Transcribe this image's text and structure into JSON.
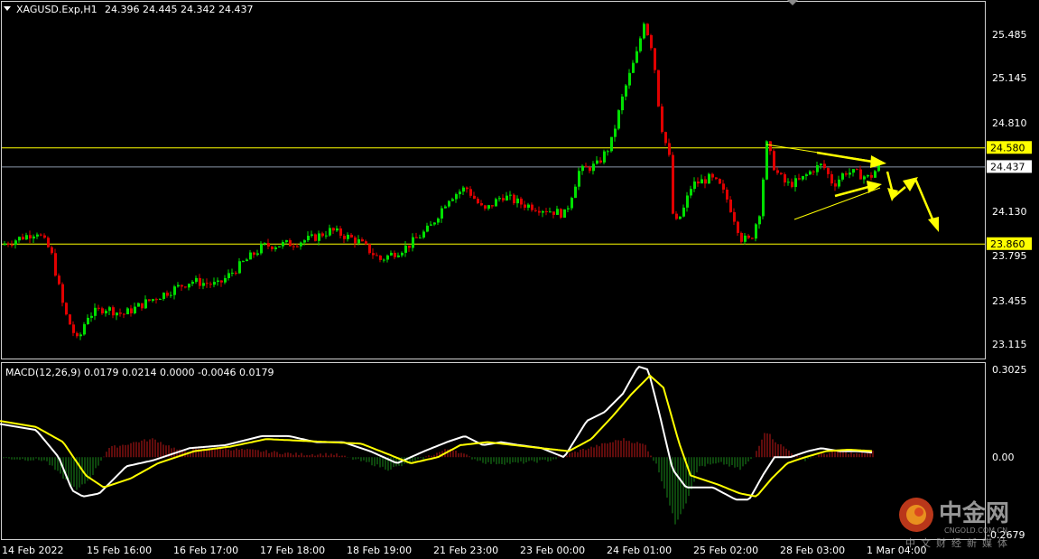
{
  "header": {
    "symbol": "XAGUSD.Exp,H1",
    "ohlc": "24.396 24.445 24.342 24.437"
  },
  "macd": {
    "label": "MACD(12,26,9) 0.0179 0.0214 0.0000 -0.0046 0.0179",
    "ticks": [
      "0.3025",
      "0.00",
      "-0.2679"
    ]
  },
  "price_axis": {
    "ticks": [
      "25.485",
      "25.145",
      "24.810",
      "24.130",
      "23.795",
      "23.455",
      "23.115"
    ]
  },
  "price_tags": [
    {
      "text": "24.580",
      "value": 24.58,
      "kind": "level"
    },
    {
      "text": "24.437",
      "value": 24.437,
      "kind": "current"
    },
    {
      "text": "23.860",
      "value": 23.86,
      "kind": "level"
    }
  ],
  "time_axis": {
    "ticks": [
      "14 Feb 2022",
      "15 Feb 16:00",
      "16 Feb 17:00",
      "17 Feb 18:00",
      "18 Feb 19:00",
      "21 Feb 23:00",
      "23 Feb 00:00",
      "24 Feb 01:00",
      "25 Feb 02:00",
      "28 Feb 03:00",
      "1 Mar 04:00"
    ]
  },
  "watermark": {
    "name": "中金网",
    "url": "CNGOLD.COM.CN",
    "slogan": "中文财经新媒体"
  },
  "colors": {
    "bull": "#00e000",
    "bear": "#e00000",
    "level_line": "#ffff00",
    "current_line": "#8a96a8",
    "macd_main": "#ffffff",
    "macd_signal": "#ffff00",
    "arrow": "#ffff00"
  },
  "chart_data": {
    "type": "candlestick",
    "title": "XAGUSD.Exp,H1",
    "ylim": [
      23.0,
      25.67
    ],
    "levels": [
      24.58,
      23.86
    ],
    "current_price": 24.437,
    "price_path": [
      [
        0,
        23.85
      ],
      [
        40,
        23.95
      ],
      [
        55,
        23.8
      ],
      [
        70,
        23.35
      ],
      [
        85,
        23.12
      ],
      [
        95,
        23.32
      ],
      [
        115,
        23.38
      ],
      [
        135,
        23.33
      ],
      [
        160,
        23.42
      ],
      [
        185,
        23.5
      ],
      [
        210,
        23.58
      ],
      [
        240,
        23.55
      ],
      [
        265,
        23.7
      ],
      [
        290,
        23.84
      ],
      [
        320,
        23.86
      ],
      [
        345,
        23.9
      ],
      [
        365,
        23.96
      ],
      [
        395,
        23.88
      ],
      [
        420,
        23.74
      ],
      [
        450,
        23.84
      ],
      [
        475,
        23.98
      ],
      [
        495,
        24.2
      ],
      [
        515,
        24.28
      ],
      [
        535,
        24.1
      ],
      [
        555,
        24.22
      ],
      [
        575,
        24.16
      ],
      [
        600,
        24.12
      ],
      [
        625,
        24.08
      ],
      [
        640,
        24.4
      ],
      [
        660,
        24.45
      ],
      [
        675,
        24.6
      ],
      [
        690,
        25.0
      ],
      [
        705,
        25.3
      ],
      [
        712,
        25.53
      ],
      [
        722,
        25.3
      ],
      [
        730,
        24.78
      ],
      [
        740,
        24.5
      ],
      [
        745,
        23.98
      ],
      [
        755,
        24.1
      ],
      [
        765,
        24.3
      ],
      [
        785,
        24.35
      ],
      [
        795,
        24.3
      ],
      [
        805,
        24.18
      ],
      [
        820,
        23.9
      ],
      [
        830,
        23.88
      ],
      [
        840,
        24.1
      ],
      [
        848,
        24.6
      ],
      [
        858,
        24.4
      ],
      [
        870,
        24.3
      ],
      [
        885,
        24.33
      ],
      [
        900,
        24.42
      ],
      [
        910,
        24.45
      ],
      [
        922,
        24.3
      ],
      [
        935,
        24.4
      ],
      [
        950,
        24.38
      ],
      [
        962,
        24.35
      ],
      [
        972,
        24.44
      ]
    ],
    "macd_histogram_path": [
      [
        0,
        -0.003
      ],
      [
        50,
        -0.01
      ],
      [
        85,
        -0.11
      ],
      [
        100,
        -0.07
      ],
      [
        120,
        0.03
      ],
      [
        150,
        0.05
      ],
      [
        170,
        0.06
      ],
      [
        200,
        0.02
      ],
      [
        240,
        0.03
      ],
      [
        290,
        0.02
      ],
      [
        330,
        0.01
      ],
      [
        370,
        0.01
      ],
      [
        410,
        -0.02
      ],
      [
        430,
        -0.04
      ],
      [
        455,
        -0.02
      ],
      [
        480,
        0.01
      ],
      [
        500,
        0.03
      ],
      [
        520,
        0.0
      ],
      [
        540,
        -0.02
      ],
      [
        570,
        -0.02
      ],
      [
        610,
        -0.01
      ],
      [
        640,
        0.02
      ],
      [
        665,
        0.04
      ],
      [
        690,
        0.06
      ],
      [
        715,
        0.04
      ],
      [
        728,
        -0.03
      ],
      [
        738,
        -0.12
      ],
      [
        748,
        -0.22
      ],
      [
        760,
        -0.15
      ],
      [
        775,
        -0.03
      ],
      [
        800,
        -0.02
      ],
      [
        820,
        -0.04
      ],
      [
        835,
        0.0
      ],
      [
        848,
        0.09
      ],
      [
        860,
        0.05
      ],
      [
        875,
        0.02
      ],
      [
        890,
        -0.01
      ],
      [
        910,
        0.01
      ],
      [
        930,
        0.02
      ],
      [
        950,
        0.01
      ],
      [
        968,
        0.02
      ]
    ],
    "macd_main_path": [
      [
        0,
        0.11
      ],
      [
        40,
        0.09
      ],
      [
        65,
        0.0
      ],
      [
        80,
        -0.11
      ],
      [
        92,
        -0.13
      ],
      [
        110,
        -0.12
      ],
      [
        140,
        -0.03
      ],
      [
        170,
        -0.01
      ],
      [
        210,
        0.03
      ],
      [
        250,
        0.04
      ],
      [
        290,
        0.07
      ],
      [
        320,
        0.07
      ],
      [
        350,
        0.05
      ],
      [
        380,
        0.05
      ],
      [
        410,
        0.02
      ],
      [
        440,
        -0.02
      ],
      [
        470,
        0.02
      ],
      [
        495,
        0.05
      ],
      [
        515,
        0.07
      ],
      [
        535,
        0.04
      ],
      [
        555,
        0.05
      ],
      [
        575,
        0.04
      ],
      [
        600,
        0.03
      ],
      [
        625,
        0.0
      ],
      [
        650,
        0.12
      ],
      [
        670,
        0.15
      ],
      [
        690,
        0.21
      ],
      [
        707,
        0.3
      ],
      [
        718,
        0.29
      ],
      [
        730,
        0.15
      ],
      [
        745,
        -0.04
      ],
      [
        760,
        -0.1
      ],
      [
        790,
        -0.1
      ],
      [
        815,
        -0.14
      ],
      [
        830,
        -0.14
      ],
      [
        845,
        -0.06
      ],
      [
        858,
        0.0
      ],
      [
        875,
        0.0
      ],
      [
        895,
        0.02
      ],
      [
        910,
        0.03
      ],
      [
        930,
        0.02
      ],
      [
        950,
        0.02
      ],
      [
        968,
        0.015
      ]
    ],
    "macd_signal_path": [
      [
        0,
        0.12
      ],
      [
        40,
        0.1
      ],
      [
        70,
        0.05
      ],
      [
        95,
        -0.06
      ],
      [
        115,
        -0.1
      ],
      [
        145,
        -0.07
      ],
      [
        175,
        -0.02
      ],
      [
        215,
        0.02
      ],
      [
        255,
        0.035
      ],
      [
        295,
        0.06
      ],
      [
        330,
        0.055
      ],
      [
        365,
        0.05
      ],
      [
        400,
        0.045
      ],
      [
        430,
        0.01
      ],
      [
        455,
        -0.02
      ],
      [
        485,
        0.0
      ],
      [
        510,
        0.04
      ],
      [
        540,
        0.05
      ],
      [
        570,
        0.04
      ],
      [
        600,
        0.03
      ],
      [
        630,
        0.02
      ],
      [
        655,
        0.06
      ],
      [
        680,
        0.14
      ],
      [
        700,
        0.21
      ],
      [
        720,
        0.27
      ],
      [
        735,
        0.23
      ],
      [
        752,
        0.05
      ],
      [
        765,
        -0.06
      ],
      [
        795,
        -0.09
      ],
      [
        820,
        -0.12
      ],
      [
        838,
        -0.13
      ],
      [
        855,
        -0.07
      ],
      [
        872,
        -0.02
      ],
      [
        892,
        0.0
      ],
      [
        915,
        0.02
      ],
      [
        940,
        0.025
      ],
      [
        968,
        0.02
      ]
    ]
  }
}
